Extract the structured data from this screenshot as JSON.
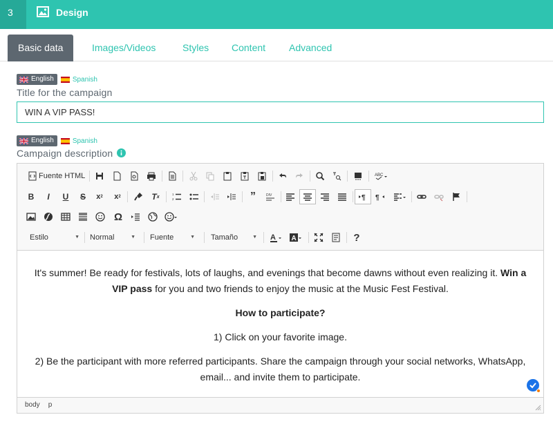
{
  "step": {
    "number": "3",
    "title": "Design"
  },
  "tabs": [
    {
      "label": "Basic data"
    },
    {
      "label": "Images/Videos"
    },
    {
      "label": "Styles"
    },
    {
      "label": "Content"
    },
    {
      "label": "Advanced"
    }
  ],
  "languages": {
    "active": "English",
    "other": "Spanish"
  },
  "title_field": {
    "label": "Title for the campaign",
    "value": "WIN A VIP PASS!"
  },
  "description_field": {
    "label": "Campaign description"
  },
  "toolbar": {
    "source_label": "Fuente HTML",
    "combos": {
      "format": "Estilo",
      "style": "Normal",
      "font": "Fuente",
      "size": "Tamaño"
    }
  },
  "content": {
    "p1_pre": "It's summer! Be ready for festivals, lots of laughs, and evenings that become dawns without even realizing it.",
    "p1_bold": "Win a VIP pass",
    "p1_post": "for you and two friends to enjoy the music at the Music Fest Festival.",
    "heading": "How to participate?",
    "step1": "1) Click on your favorite image.",
    "step2": "2) Be the participant with more referred participants. Share the campaign through your social networks, WhatsApp, email... and invite them to participate."
  },
  "statusbar": {
    "path1": "body",
    "path2": "p"
  },
  "colors": {
    "accent": "#2ec4b0",
    "tab_active": "#5d6770"
  }
}
